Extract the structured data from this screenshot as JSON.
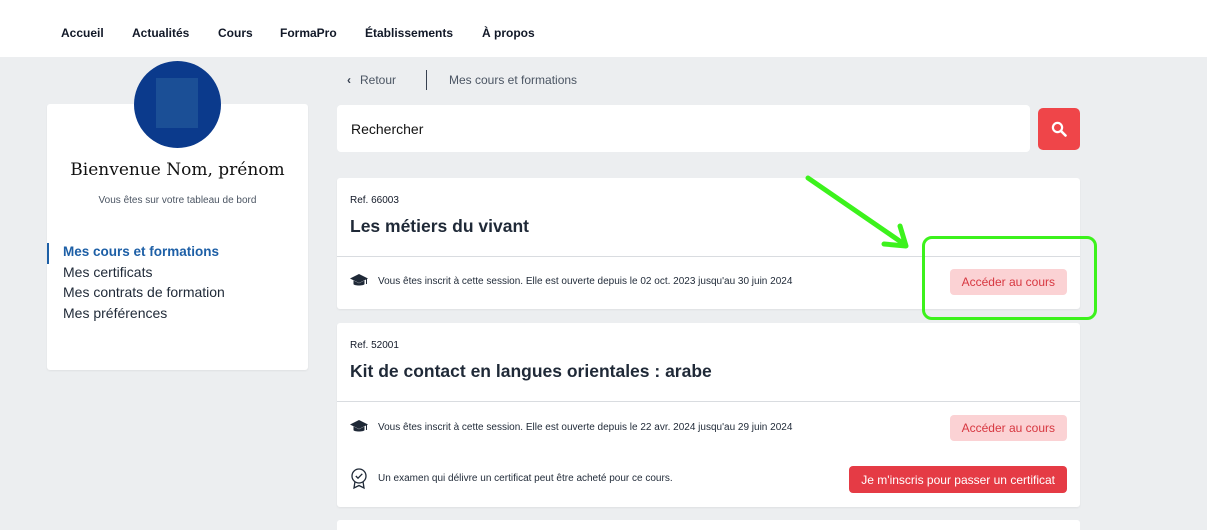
{
  "nav": {
    "items": [
      "Accueil",
      "Actualités",
      "Cours",
      "FormaPro",
      "Établissements",
      "À propos"
    ]
  },
  "sidebar": {
    "welcome": "Bienvenue Nom, prénom",
    "subtitle": "Vous êtes sur votre tableau de bord",
    "menu": [
      "Mes cours et formations",
      "Mes certificats",
      "Mes contrats de formation",
      "Mes préférences"
    ],
    "active_index": 0
  },
  "breadcrumb": {
    "back_label": "Retour",
    "current": "Mes cours et formations"
  },
  "search": {
    "placeholder": "Rechercher"
  },
  "courses": [
    {
      "ref": "Ref. 66003",
      "title": "Les métiers du vivant",
      "session_text": "Vous êtes inscrit à cette session. Elle est ouverte depuis le 02 oct. 2023 jusqu'au 30 juin 2024",
      "access_label": "Accéder au cours"
    },
    {
      "ref": "Ref. 52001",
      "title": "Kit de contact en langues orientales : arabe",
      "session_text": "Vous êtes inscrit à cette session. Elle est ouverte depuis le 22 avr. 2024 jusqu'au 29 juin 2024",
      "access_label": "Accéder au cours",
      "certificate_text": "Un examen qui délivre un certificat peut être acheté pour ce cours.",
      "certificate_label": "Je m'inscris pour passer un certificat"
    }
  ],
  "colors": {
    "accent_red": "#ef4549",
    "access_bg": "#fbd2d4",
    "access_text": "#d73740",
    "active_menu": "#1d5fa6",
    "annotation": "#3cf21c"
  },
  "icons": {
    "search": "search-icon",
    "session": "graduation-cap-icon",
    "certificate": "certificate-badge-icon",
    "back": "chevron-left-icon"
  }
}
